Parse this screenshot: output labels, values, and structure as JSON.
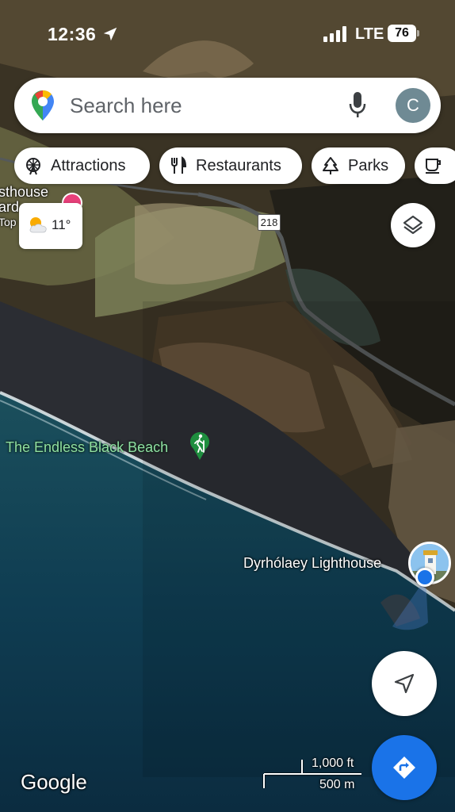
{
  "status_bar": {
    "time": "12:36",
    "network": "LTE",
    "battery": "76"
  },
  "search": {
    "placeholder": "Search here",
    "avatar_initial": "C"
  },
  "chips": [
    {
      "label": "Attractions",
      "icon": "ferris-wheel-icon"
    },
    {
      "label": "Restaurants",
      "icon": "fork-knife-icon"
    },
    {
      "label": "Parks",
      "icon": "tree-icon"
    },
    {
      "label": "Coffee",
      "icon": "coffee-cup-icon"
    }
  ],
  "weather": {
    "temperature": "11°",
    "icon": "partly-cloudy-icon"
  },
  "map": {
    "road_number": "218",
    "poi_partial": {
      "line1": "sthouse",
      "line2": "ard",
      "line3": "Top"
    },
    "beach": {
      "label": "The Endless Black Beach",
      "icon": "hiking-icon"
    },
    "lighthouse": {
      "label": "Dyrhólaey Lighthouse"
    },
    "colors": {
      "ocean": "#0f3f52",
      "land": "#3a3324",
      "beach": "#2b2d33",
      "accent_blue": "#1a73e8",
      "label_green": "#8fe0a2"
    }
  },
  "scale": {
    "imperial": "1,000 ft",
    "metric": "500 m"
  },
  "branding": {
    "logo_text": "Google"
  }
}
